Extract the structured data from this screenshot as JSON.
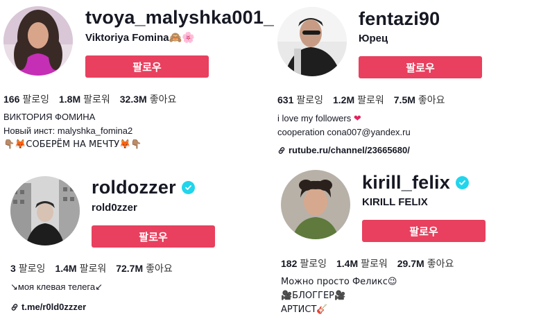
{
  "profiles": [
    {
      "username": "tvoya_malyshka001_",
      "nickname": "Viktoriya Fomina",
      "nickname_emoji": "🙈🌸",
      "follow_label": "팔로우",
      "following_count": "166",
      "following_label": "팔로잉",
      "followers_count": "1.8M",
      "followers_label": "팔로워",
      "likes_count": "32.3M",
      "likes_label": "좋아요",
      "bio_lines": [
        "ВИКТОРИЯ ФОМИНА",
        "Новый инст: malyshka_fomina2",
        "👇🏽🦊СОБЕРЁМ НА МЕЧТУ🦊👇🏽"
      ],
      "verified": false
    },
    {
      "username": "fentazi90",
      "nickname": "Юрец",
      "follow_label": "팔로우",
      "following_count": "631",
      "following_label": "팔로잉",
      "followers_count": "1.2M",
      "followers_label": "팔로워",
      "likes_count": "7.5M",
      "likes_label": "좋아요",
      "bio_lines": [
        "i love my followers",
        "cooperation cona007@yandex.ru"
      ],
      "bio_heart": "❤",
      "link": "rutube.ru/channel/23665680/",
      "verified": false
    },
    {
      "username": "roldozzer",
      "nickname": "rold0zzer",
      "follow_label": "팔로우",
      "following_count": "3",
      "following_label": "팔로잉",
      "followers_count": "1.4M",
      "followers_label": "팔로워",
      "likes_count": "72.7M",
      "likes_label": "좋아요",
      "bio_lines": [
        "↘моя клевая телега↙"
      ],
      "link": "t.me/r0ld0zzzer",
      "verified": true
    },
    {
      "username": "kirill_felix",
      "nickname": "KIRILL FELIX",
      "follow_label": "팔로우",
      "following_count": "182",
      "following_label": "팔로잉",
      "followers_count": "1.4M",
      "followers_label": "팔로워",
      "likes_count": "29.7M",
      "likes_label": "좋아요",
      "bio_lines": [
        "Можно просто Феликс😉",
        "🎥БЛОГГЕР🎥",
        "АРТИСТ🎸"
      ],
      "verified": true
    }
  ],
  "icons": {
    "link": "link-icon",
    "verified": "verified-check-icon"
  },
  "colors": {
    "follow_button": "#e8405e",
    "verified_badge": "#20d5ec",
    "text": "#161823"
  }
}
